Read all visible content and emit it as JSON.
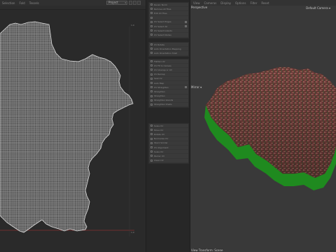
{
  "left_menubar": {
    "items": [
      "Selection",
      "Fold",
      "Tessels"
    ]
  },
  "preset_select": {
    "value": "Project"
  },
  "uv_editor": {
    "top_right_coord": "1.0",
    "bottom_right_coord": "1.0"
  },
  "side_panel": {
    "group1": [
      "Recalc Norm",
      "Remove All Files",
      "Edit UV Files",
      "",
      "UV Select Edges",
      "UV Select All",
      "UV Select Islands",
      "UV Select Nodes"
    ],
    "group2": [
      "UV Rotate",
      "Auto Orientation Mapping",
      "Auto Orientation Shell"
    ],
    "group3": [
      "Flatten UV",
      "UV Fit to Canvas",
      "UV Unwrap or UV",
      "UV Remap",
      "Seal UV",
      "Auto Map",
      "UV Straighten",
      "Straighten",
      "Straighten",
      "Straighten Islands",
      "Straighten Shells"
    ],
    "group4": [
      "Scale UV",
      "Move UV",
      "Rotate UV",
      "Normalize UV",
      "Stack Similar",
      "UV Alignment",
      "Scale UV",
      "Packer UV",
      "Clean UV"
    ]
  },
  "right_menubar": {
    "items": [
      "View",
      "Cameras",
      "Display",
      "Options",
      "Filter",
      "Reset"
    ]
  },
  "viewport": {
    "view_label": "Perspective",
    "camera_select": "Default Camera",
    "mirror_label": "Mirror",
    "footer_label": "View Transform: Scene"
  },
  "colors": {
    "uv_wireframe": "#c8c8c8",
    "terrain_side": "#1f8a1f",
    "terrain_top": "#6a3a36",
    "baseline": "#b03030"
  }
}
